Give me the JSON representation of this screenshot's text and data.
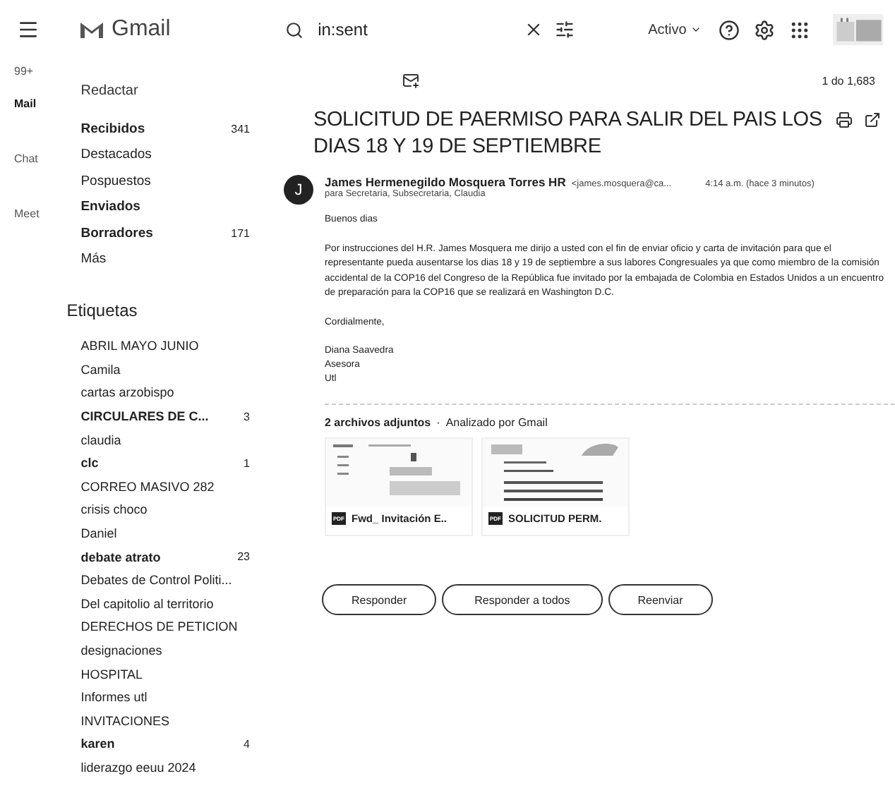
{
  "header": {
    "app_name": "Gmail",
    "search": {
      "value": "in:sent"
    },
    "status": "Activo"
  },
  "rail": {
    "badge": "99+",
    "items": [
      {
        "label": "Mail",
        "selected": true
      },
      {
        "label": "Chat",
        "selected": false
      },
      {
        "label": "Meet",
        "selected": false
      }
    ]
  },
  "compose": "Redactar",
  "nav": [
    {
      "label": "Recibidos",
      "bold": true,
      "count": "341"
    },
    {
      "label": "Destacados",
      "bold": false
    },
    {
      "label": "Pospuestos",
      "bold": false
    },
    {
      "label": "Enviados",
      "bold": true
    },
    {
      "label": "Borradores",
      "bold": true,
      "count": "171"
    },
    {
      "label": "Más",
      "bold": false
    }
  ],
  "labels_title": "Etiquetas",
  "labels": [
    {
      "label": "ABRIL MAYO JUNIO",
      "bold": false
    },
    {
      "label": "Camila",
      "bold": false
    },
    {
      "label": "cartas arzobispo",
      "bold": false
    },
    {
      "label": "CIRCULARES DE C...",
      "bold": true,
      "count": "3"
    },
    {
      "label": "claudia",
      "bold": false
    },
    {
      "label": "clc",
      "bold": true,
      "count": "1"
    },
    {
      "label": "CORREO MASIVO 282",
      "bold": false
    },
    {
      "label": "crisis choco",
      "bold": false
    },
    {
      "label": "Daniel",
      "bold": false
    },
    {
      "label": "debate atrato",
      "bold": true,
      "count": "23"
    },
    {
      "label": "Debates de Control Politi...",
      "bold": false
    },
    {
      "label": "Del capitolio al territorio",
      "bold": false
    },
    {
      "label": "DERECHOS DE PETICION",
      "bold": false
    },
    {
      "label": "designaciones",
      "bold": false
    },
    {
      "label": "HOSPITAL",
      "bold": false
    },
    {
      "label": "Informes utl",
      "bold": false
    },
    {
      "label": "INVITACIONES",
      "bold": false
    },
    {
      "label": "karen",
      "bold": true,
      "count": "4"
    },
    {
      "label": "liderazgo eeuu 2024",
      "bold": false
    }
  ],
  "pager": "1 do 1,683",
  "message": {
    "subject": "SOLICITUD DE PAERMISO PARA SALIR DEL PAIS LOS DIAS 18 Y 19 DE SEPTIEMBRE",
    "avatar": "J",
    "sender": "James Hermenegildo Mosquera Torres HR",
    "sender_email": "<james.mosquera@ca...",
    "time": "4:14 a.m. (hace 3 minutos)",
    "recipients": "para Secretaria, Subsecretaria, Claudia",
    "body": [
      "Buenos dias",
      "Por instrucciones del H.R. James Mosquera me dirijo a usted con el fin de enviar oficio y carta de invitación para que el representante pueda ausentarse los dias 18 y 19 de septiembre a sus labores Congresuales ya que como miembro de la comisión accidental de la COP16 del Congreso de la República fue invitado por la embajada de Colombia en Estados Unidos a un encuentro de preparación para la COP16 que se realizará en Washington  D.C.",
      "Cordialmente,"
    ],
    "signature": [
      "Diana Saavedra",
      "Asesora",
      "Utl"
    ],
    "attachments_title": "2 archivos adjuntos",
    "separator": "·",
    "scan_note": "Analizado por Gmail",
    "attachments": [
      {
        "type_badge": "PDF",
        "name": "Fwd_ Invitación E..",
        "kind": "screen"
      },
      {
        "type_badge": "PDF",
        "name": "SOLICITUD PERM.",
        "kind": "letter"
      }
    ],
    "actions": [
      "Responder",
      "Responder a todos",
      "Reenviar"
    ]
  }
}
